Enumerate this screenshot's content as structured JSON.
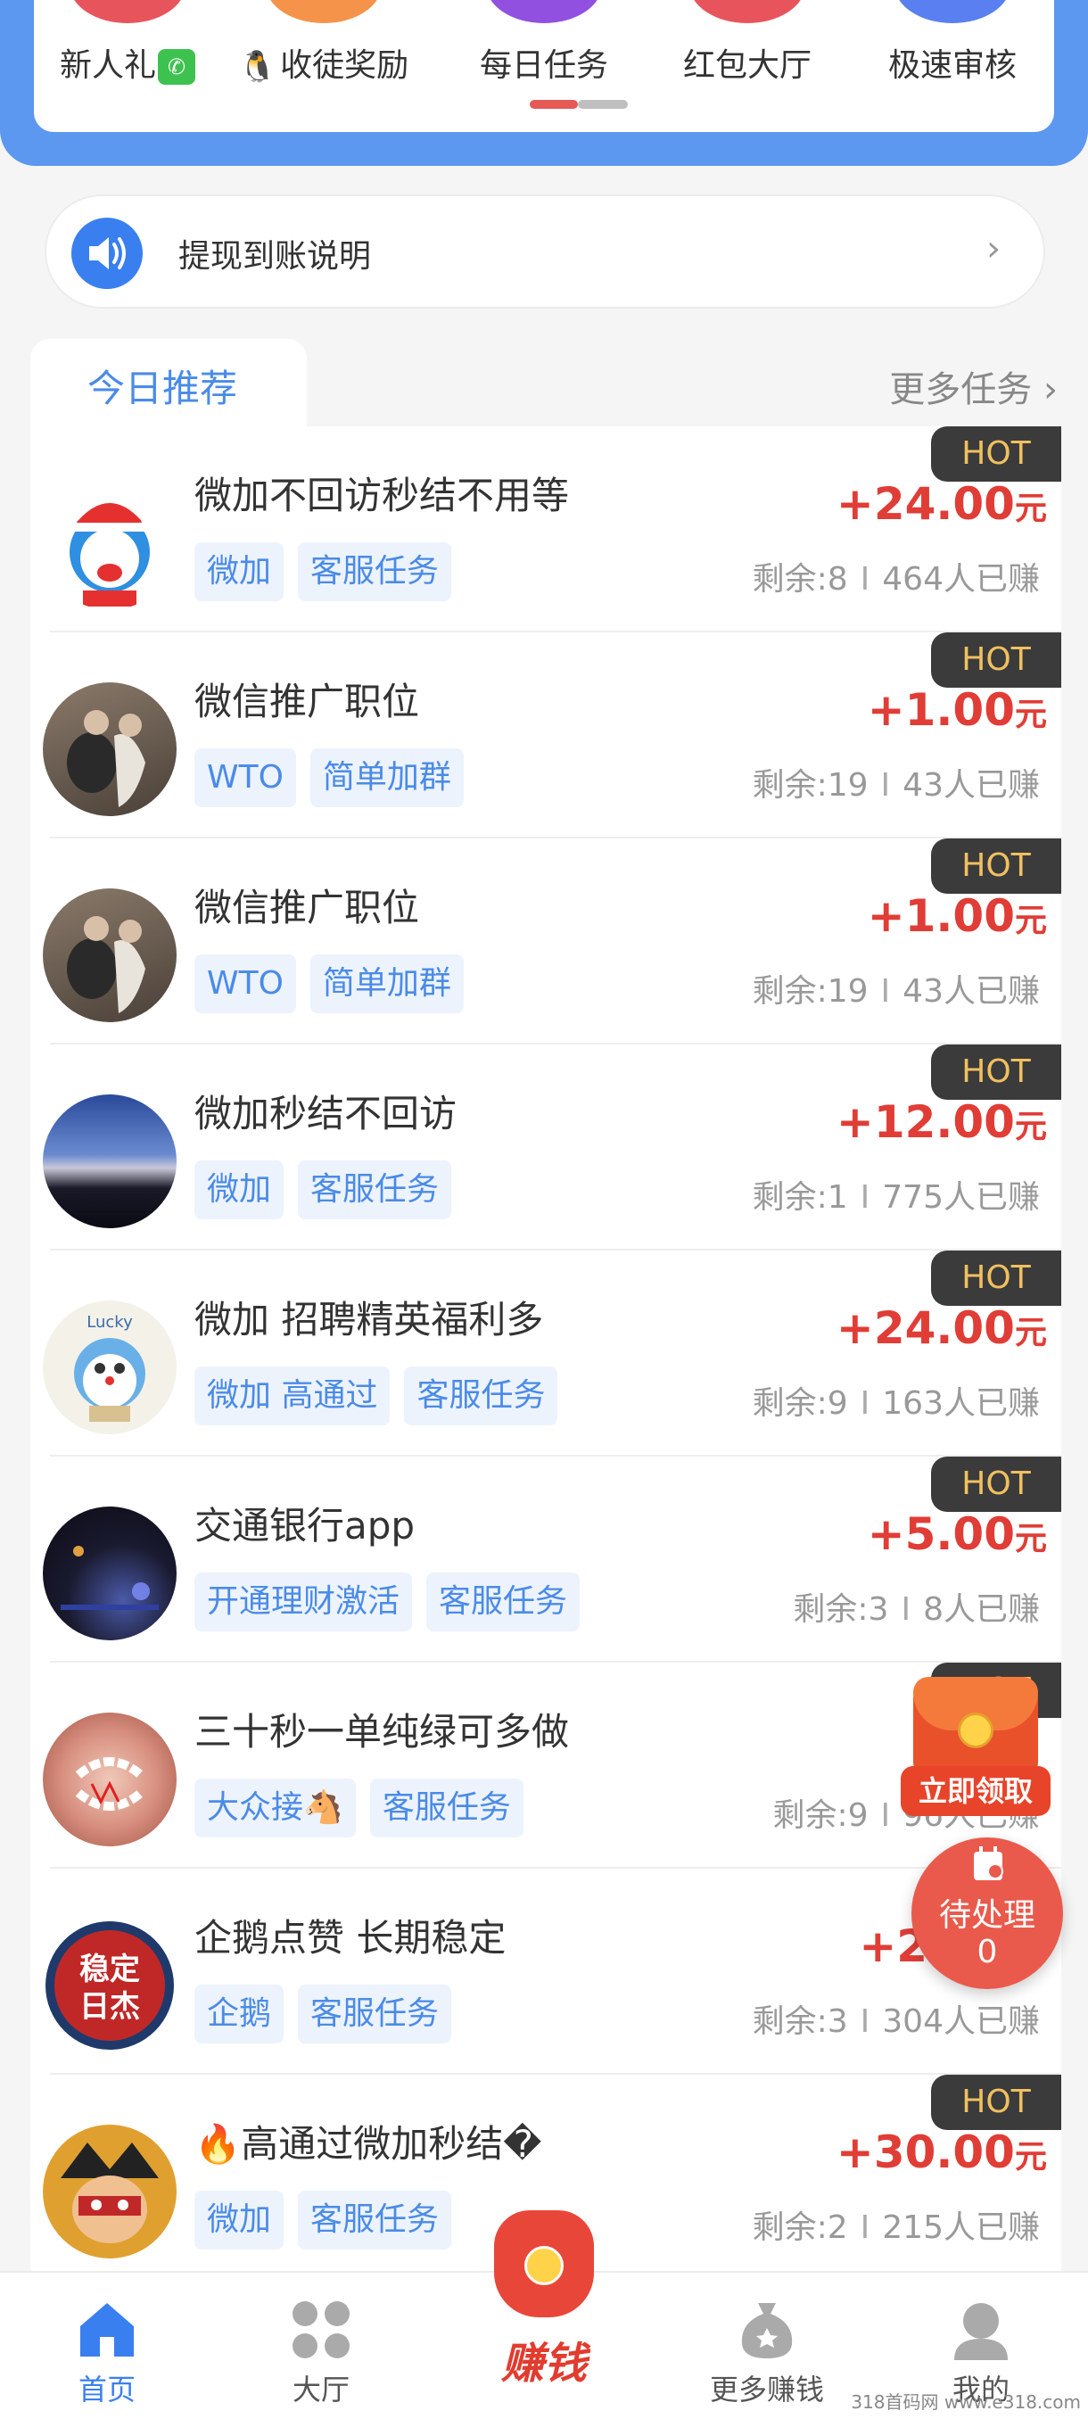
{
  "categories": [
    {
      "label": "新人礼",
      "badge": "微信",
      "color": "#e8545c"
    },
    {
      "label": "收徒奖励",
      "prefix_icon": "qq-penguin-icon",
      "color": "#f5934a"
    },
    {
      "label": "每日任务",
      "color": "#9150e0"
    },
    {
      "label": "红包大厅",
      "color": "#e8545c"
    },
    {
      "label": "极速审核",
      "color": "#5a7ff0"
    }
  ],
  "notice": {
    "text": "提现到账说明"
  },
  "tabs": {
    "active": "今日推荐",
    "more": "更多任务"
  },
  "hot_label": "HOT",
  "currency_unit": "元",
  "remaining_prefix": "剩余:",
  "earned_suffix": "人已赚",
  "tasks": [
    {
      "title": "微加不回访秒结不用等",
      "tags": [
        "微加",
        "客服任务"
      ],
      "price": "+24.00",
      "remaining": "8",
      "earned": "464"
    },
    {
      "title": "微信推广职位",
      "tags": [
        "WTO",
        "简单加群"
      ],
      "price": "+1.00",
      "remaining": "19",
      "earned": "43"
    },
    {
      "title": "微信推广职位",
      "tags": [
        "WTO",
        "简单加群"
      ],
      "price": "+1.00",
      "remaining": "19",
      "earned": "43"
    },
    {
      "title": "微加秒结不回访",
      "tags": [
        "微加",
        "客服任务"
      ],
      "price": "+12.00",
      "remaining": "1",
      "earned": "775"
    },
    {
      "title": "微加 招聘精英福利多",
      "tags": [
        "微加 高通过",
        "客服任务"
      ],
      "price": "+24.00",
      "remaining": "9",
      "earned": "163"
    },
    {
      "title": "交通银行app",
      "tags": [
        "开通理财激活",
        "客服任务"
      ],
      "price": "+5.00",
      "remaining": "3",
      "earned": "8"
    },
    {
      "title": "三十秒一单纯绿可多做",
      "tags": [
        "大众接🐴",
        "客服任务"
      ],
      "price": "",
      "remaining": "9",
      "earned": "96"
    },
    {
      "title": "企鹅点赞 长期稳定",
      "tags": [
        "企鹅",
        "客服任务"
      ],
      "price": "+2",
      "remaining": "3",
      "earned": "304"
    },
    {
      "title": "🔥高通过微加秒结�",
      "tags": [
        "微加",
        "客服任务"
      ],
      "price": "+30.00",
      "remaining": "2",
      "earned": "215"
    }
  ],
  "float_redpack": {
    "label": "立即领取"
  },
  "float_pending": {
    "label": "待处理",
    "count": "0"
  },
  "avatar_text": {
    "stamp_line1": "稳定",
    "stamp_line2": "日杰",
    "lucky": "Lucky"
  },
  "nav": {
    "home": "首页",
    "hall": "大厅",
    "earn": "赚钱",
    "more": "更多赚钱",
    "mine": "我的"
  },
  "watermark": "318首码网 www.e318.com",
  "colors": {
    "accent": "#3a7ff0",
    "price": "#e03d36",
    "hot_bg": "#3b3b3b",
    "hot_text": "#f0c060",
    "tag_bg": "#edf3fc"
  }
}
